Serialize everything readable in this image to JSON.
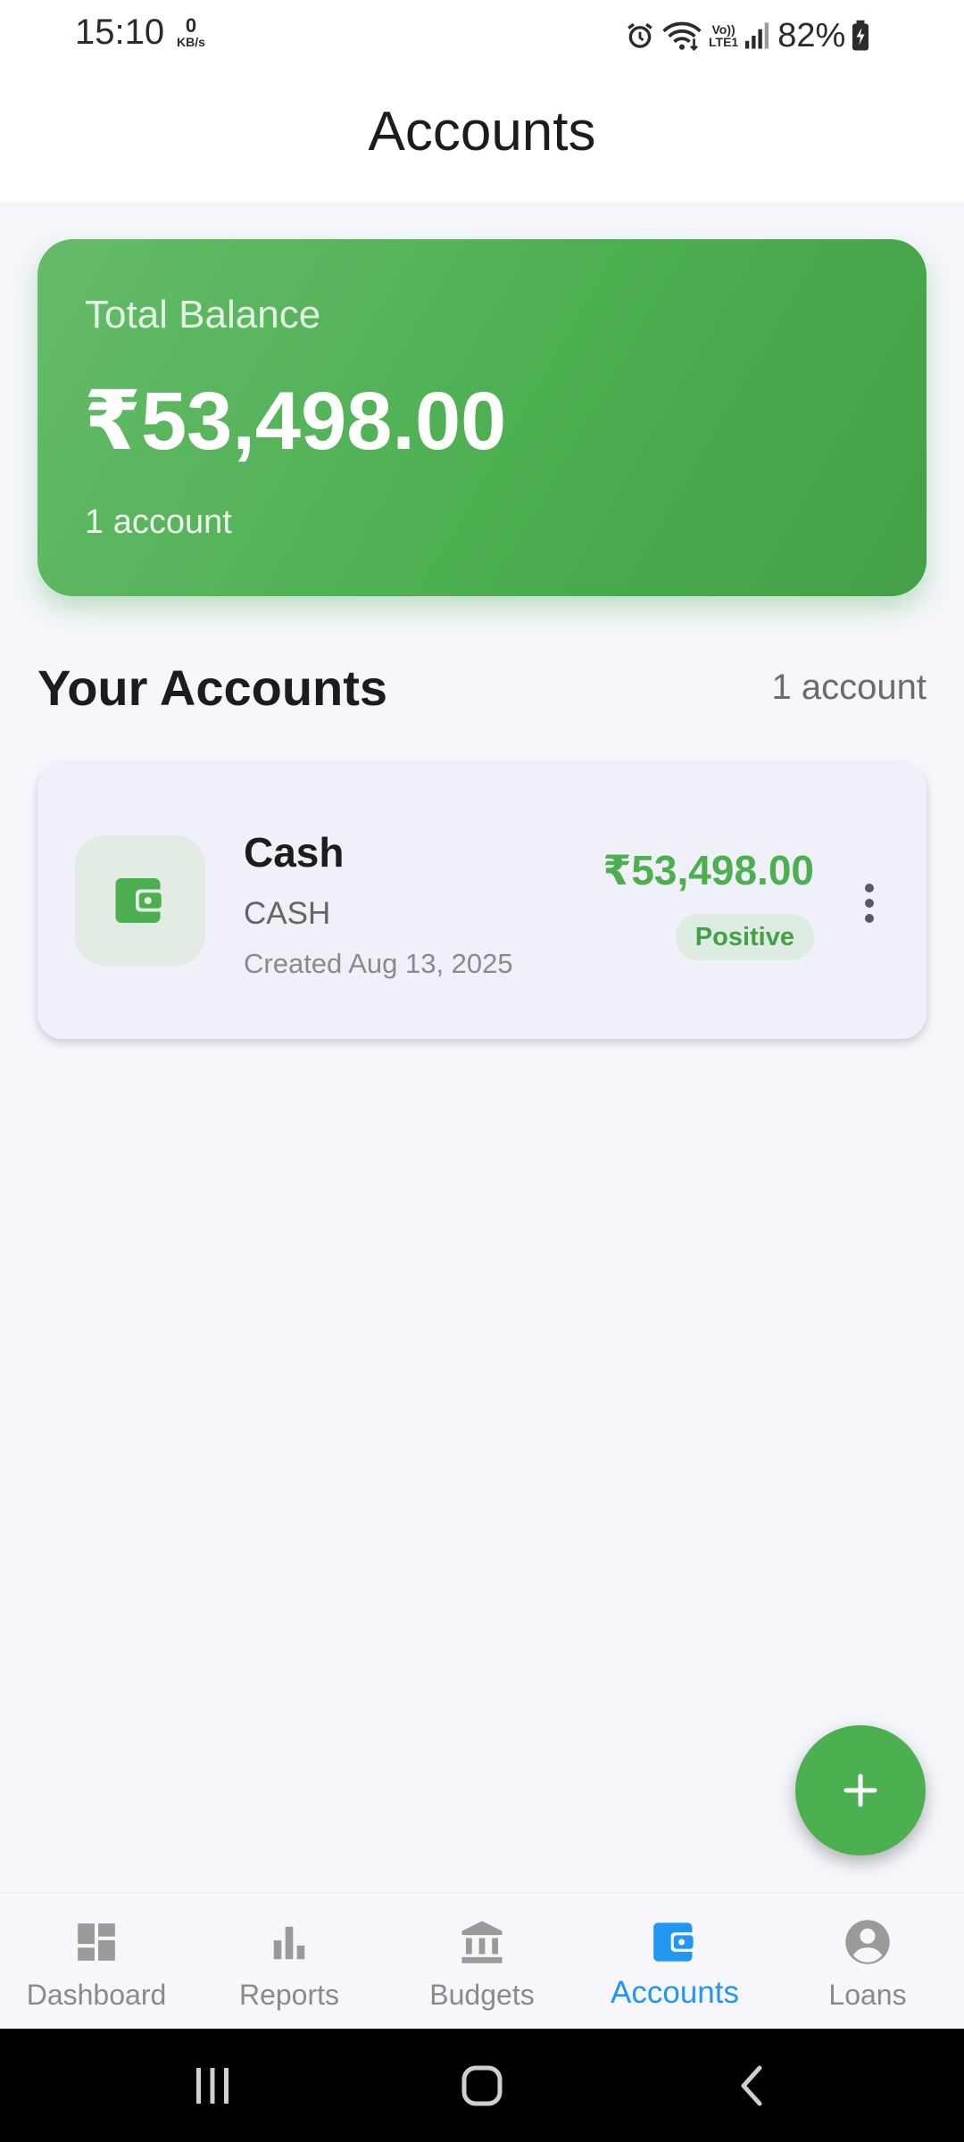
{
  "status_bar": {
    "time": "15:10",
    "speed_value": "0",
    "speed_unit": "KB/s",
    "volte_top": "Vo))",
    "volte_bottom": "LTE1",
    "battery": "82%"
  },
  "app_bar": {
    "title": "Accounts"
  },
  "balance_card": {
    "label": "Total Balance",
    "amount": "₹53,498.00",
    "count": "1 account",
    "gradient_colors": [
      "#66bb6a",
      "#43a047"
    ]
  },
  "section": {
    "title": "Your Accounts",
    "count": "1 account"
  },
  "accounts": [
    {
      "name": "Cash",
      "type": "CASH",
      "created": "Created Aug 13, 2025",
      "balance": "₹53,498.00",
      "status": "Positive",
      "icon": "wallet-icon"
    }
  ],
  "fab": {
    "icon": "plus-icon",
    "color": "#4caf50"
  },
  "bottom_nav": {
    "active": "Accounts",
    "active_color": "#2196f3",
    "items": [
      {
        "label": "Dashboard",
        "icon": "dashboard-icon"
      },
      {
        "label": "Reports",
        "icon": "bar-chart-icon"
      },
      {
        "label": "Budgets",
        "icon": "bank-icon"
      },
      {
        "label": "Accounts",
        "icon": "wallet-icon"
      },
      {
        "label": "Loans",
        "icon": "account-circle-icon"
      }
    ]
  },
  "system_nav": {
    "buttons": [
      "recents-icon",
      "home-icon",
      "back-icon"
    ]
  },
  "colors": {
    "accent_green": "#4caf50",
    "background": "#f5f6fb",
    "nav_active": "#2196f3"
  }
}
